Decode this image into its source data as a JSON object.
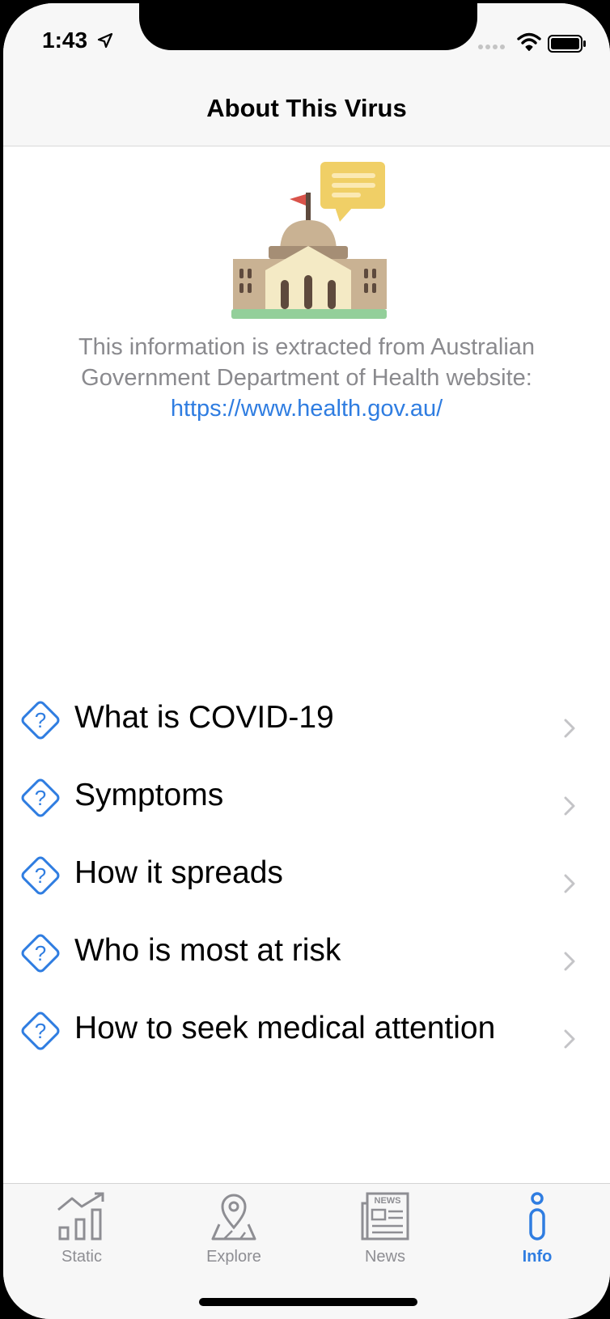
{
  "status_bar": {
    "time": "1:43"
  },
  "nav": {
    "title": "About This Virus"
  },
  "intro": {
    "text": "This information is extracted from Australian Government Department of Health website:",
    "link": "https://www.health.gov.au/"
  },
  "faq": {
    "items": [
      {
        "label": "What is COVID-19",
        "icon": "question-diamond-icon"
      },
      {
        "label": "Symptoms",
        "icon": "question-diamond-icon"
      },
      {
        "label": "How it spreads",
        "icon": "question-diamond-icon"
      },
      {
        "label": "Who is most at risk",
        "icon": "question-diamond-icon"
      },
      {
        "label": "How to seek medical attention",
        "icon": "question-diamond-icon"
      }
    ]
  },
  "tabbar": {
    "tabs": [
      {
        "label": "Static",
        "icon": "chart-icon",
        "active": false
      },
      {
        "label": "Explore",
        "icon": "map-pin-icon",
        "active": false
      },
      {
        "label": "News",
        "icon": "newspaper-icon",
        "active": false
      },
      {
        "label": "Info",
        "icon": "info-icon",
        "active": true
      }
    ]
  },
  "colors": {
    "accent": "#2f7de1",
    "muted_text": "#8a8a8e",
    "bar_background": "#f7f7f7"
  }
}
